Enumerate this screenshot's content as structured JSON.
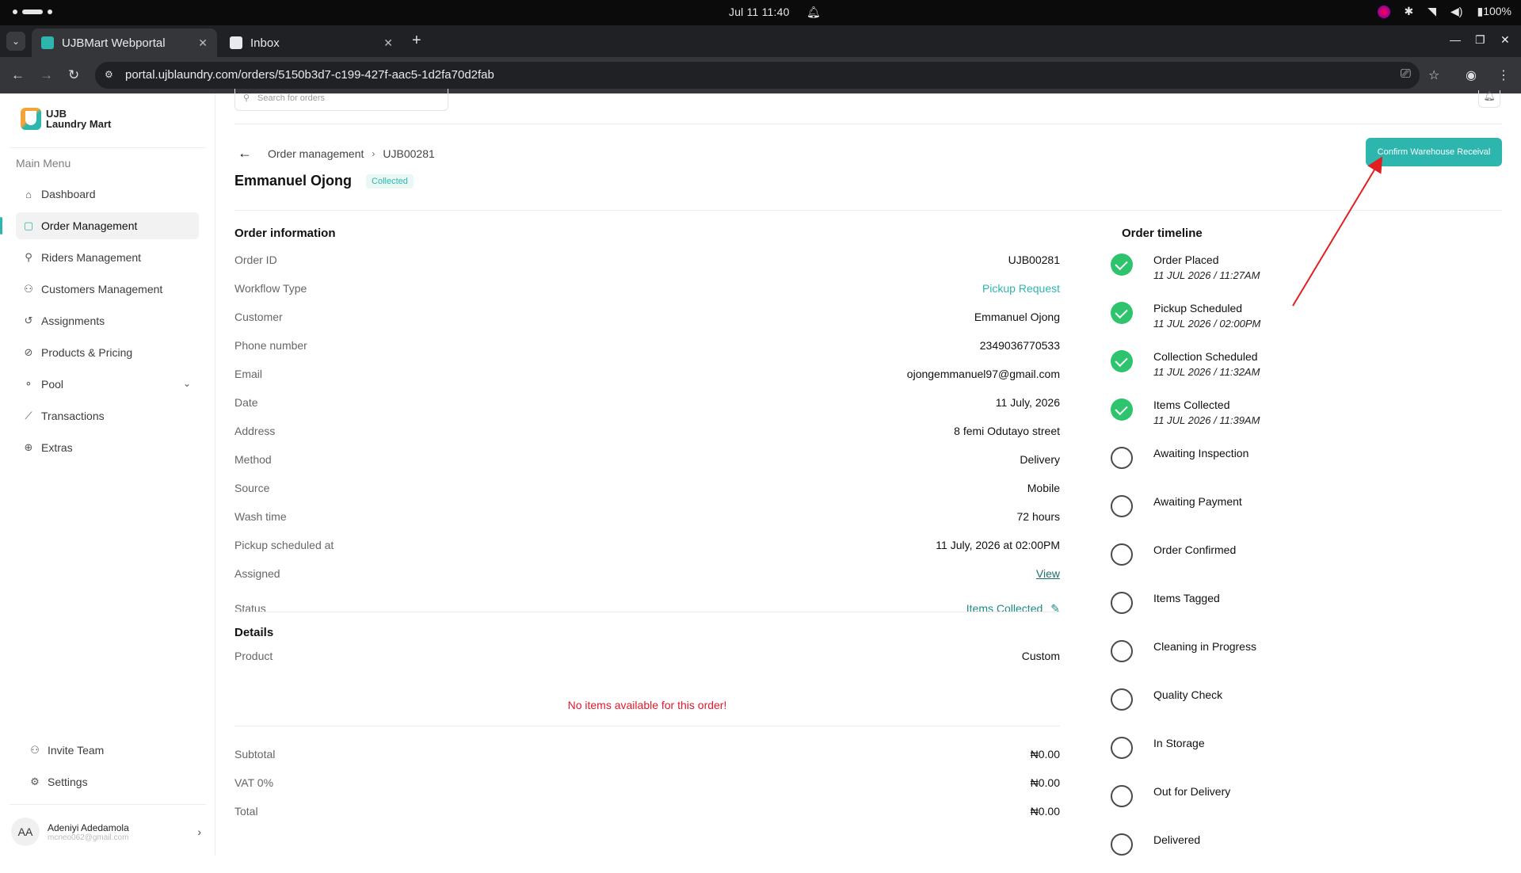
{
  "os": {
    "clock": "Jul 11  11:40",
    "battery": "100%"
  },
  "browser": {
    "tabs": [
      {
        "label": "UJBMart Webportal",
        "active": true
      },
      {
        "label": "Inbox",
        "active": false
      }
    ],
    "url": "portal.ujblaundry.com/orders/5150b3d7-c199-427f-aac5-1d2fa70d2fab"
  },
  "sidebar": {
    "logo_line1": "UJB",
    "logo_line2": "Laundry Mart",
    "menu_title": "Main Menu",
    "items": [
      {
        "label": "Dashboard",
        "icon": "home-icon"
      },
      {
        "label": "Order Management",
        "icon": "cart-icon",
        "active": true
      },
      {
        "label": "Riders Management",
        "icon": "bike-icon"
      },
      {
        "label": "Customers Management",
        "icon": "users-icon"
      },
      {
        "label": "Assignments",
        "icon": "history-icon"
      },
      {
        "label": "Products & Pricing",
        "icon": "tag-icon"
      },
      {
        "label": "Pool",
        "icon": "pool-icon"
      },
      {
        "label": "Transactions",
        "icon": "chart-icon"
      },
      {
        "label": "Extras",
        "icon": "globe-icon"
      }
    ],
    "bottom": [
      {
        "label": "Invite Team",
        "icon": "user-plus-icon"
      },
      {
        "label": "Settings",
        "icon": "gear-icon"
      }
    ],
    "user": {
      "initials": "AA",
      "name": "Adeniyi Adedamola",
      "email": "mcneo062@gmail.com"
    }
  },
  "main": {
    "search_placeholder": "Search for orders",
    "breadcrumb": [
      "Order management",
      "UJB00281"
    ],
    "title": "Emmanuel Ojong",
    "badge": "Collected",
    "confirm_button": "Confirm Warehouse Receival",
    "order_info_title": "Order information",
    "rows": [
      {
        "k": "Order ID",
        "v": "UJB00281"
      },
      {
        "k": "Workflow Type",
        "v": "Pickup Request"
      },
      {
        "k": "Customer",
        "v": "Emmanuel Ojong"
      },
      {
        "k": "Phone number",
        "v": "2349036770533"
      },
      {
        "k": "Email",
        "v": "ojongemmanuel97@gmail.com"
      },
      {
        "k": "Date",
        "v": "11 July, 2026"
      },
      {
        "k": "Address",
        "v": "8 femi Odutayo street"
      },
      {
        "k": "Method",
        "v": "Delivery"
      },
      {
        "k": "Source",
        "v": "Mobile"
      },
      {
        "k": "Wash time",
        "v": "72 hours"
      },
      {
        "k": "Pickup scheduled at",
        "v": "11 July, 2026 at 02:00PM"
      },
      {
        "k": "Assigned",
        "v": "View"
      },
      {
        "k": "Status",
        "v": "Items Collected"
      }
    ],
    "details_title": "Details",
    "details_rows": [
      {
        "k": "Product",
        "v": "Custom"
      }
    ],
    "empty_message": "No items available for this order!",
    "totals": [
      {
        "k": "Subtotal",
        "v": "₦0.00"
      },
      {
        "k": "VAT 0%",
        "v": "₦0.00"
      },
      {
        "k": "Total",
        "v": "₦0.00"
      }
    ]
  },
  "timeline": {
    "title": "Order timeline",
    "steps": [
      {
        "label": "Order Placed",
        "time": "11 JUL 2026 / 11:27AM",
        "done": true
      },
      {
        "label": "Pickup Scheduled",
        "time": "11 JUL 2026 / 02:00PM",
        "done": true
      },
      {
        "label": "Collection Scheduled",
        "time": "11 JUL 2026 / 11:32AM",
        "done": true
      },
      {
        "label": "Items Collected",
        "time": "11 JUL 2026 / 11:39AM",
        "done": true
      },
      {
        "label": "Awaiting Inspection",
        "time": "",
        "done": false
      },
      {
        "label": "Awaiting Payment",
        "time": "",
        "done": false
      },
      {
        "label": "Order Confirmed",
        "time": "",
        "done": false
      },
      {
        "label": "Items Tagged",
        "time": "",
        "done": false
      },
      {
        "label": "Cleaning in Progress",
        "time": "",
        "done": false
      },
      {
        "label": "Quality Check",
        "time": "",
        "done": false
      },
      {
        "label": "In Storage",
        "time": "",
        "done": false
      },
      {
        "label": "Out for Delivery",
        "time": "",
        "done": false
      },
      {
        "label": "Delivered",
        "time": "",
        "done": false
      }
    ]
  },
  "colors": {
    "accent": "#2cb6ae",
    "done": "#2ec46e",
    "error": "#e0192d",
    "annotation_arrow": "#e02020"
  }
}
